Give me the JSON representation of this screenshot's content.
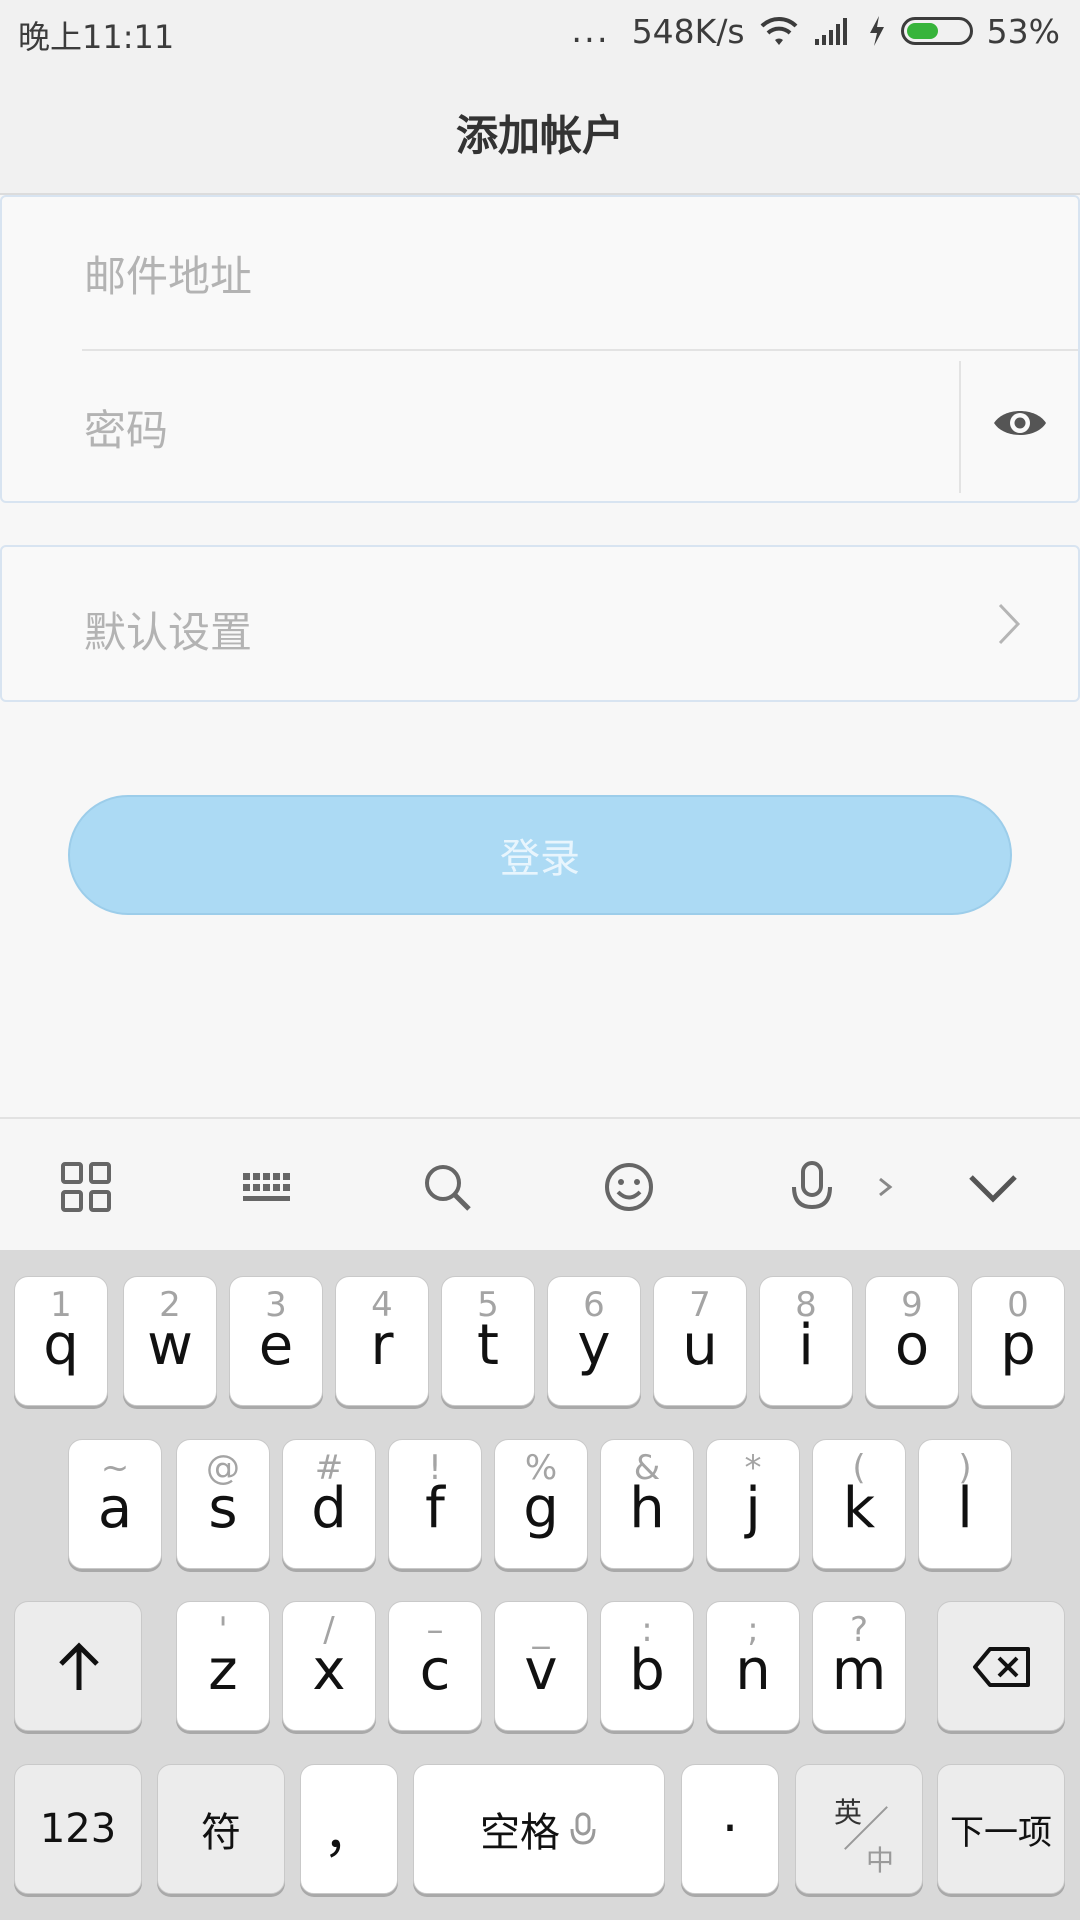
{
  "status_bar": {
    "time": "晚上11:11",
    "dots": "...",
    "speed": "548K/s",
    "battery": "53%",
    "battery_level": 0.53
  },
  "header": {
    "title": "添加帐户"
  },
  "form": {
    "email_placeholder": "邮件地址",
    "password_placeholder": "密码"
  },
  "defaults": {
    "label": "默认设置"
  },
  "login": {
    "label": "登录"
  },
  "keyboard": {
    "row1": [
      {
        "hint": "1",
        "key": "q"
      },
      {
        "hint": "2",
        "key": "w"
      },
      {
        "hint": "3",
        "key": "e"
      },
      {
        "hint": "4",
        "key": "r"
      },
      {
        "hint": "5",
        "key": "t"
      },
      {
        "hint": "6",
        "key": "y"
      },
      {
        "hint": "7",
        "key": "u"
      },
      {
        "hint": "8",
        "key": "i"
      },
      {
        "hint": "9",
        "key": "o"
      },
      {
        "hint": "0",
        "key": "p"
      }
    ],
    "row2": [
      {
        "hint": "~",
        "key": "a"
      },
      {
        "hint": "@",
        "key": "s"
      },
      {
        "hint": "#",
        "key": "d"
      },
      {
        "hint": "!",
        "key": "f"
      },
      {
        "hint": "%",
        "key": "g"
      },
      {
        "hint": "&",
        "key": "h"
      },
      {
        "hint": "*",
        "key": "j"
      },
      {
        "hint": "(",
        "key": "k"
      },
      {
        "hint": ")",
        "key": "l"
      }
    ],
    "row3": [
      {
        "hint": "'",
        "key": "z"
      },
      {
        "hint": "/",
        "key": "x"
      },
      {
        "hint": "–",
        "key": "c"
      },
      {
        "hint": "_",
        "key": "v"
      },
      {
        "hint": ":",
        "key": "b"
      },
      {
        "hint": ";",
        "key": "n"
      },
      {
        "hint": "?",
        "key": "m"
      }
    ],
    "numbers": "123",
    "symbols": "符",
    "comma": "，",
    "space": "空格",
    "period": "·",
    "lang_top": "英",
    "lang_bottom": "中",
    "next": "下一项"
  }
}
